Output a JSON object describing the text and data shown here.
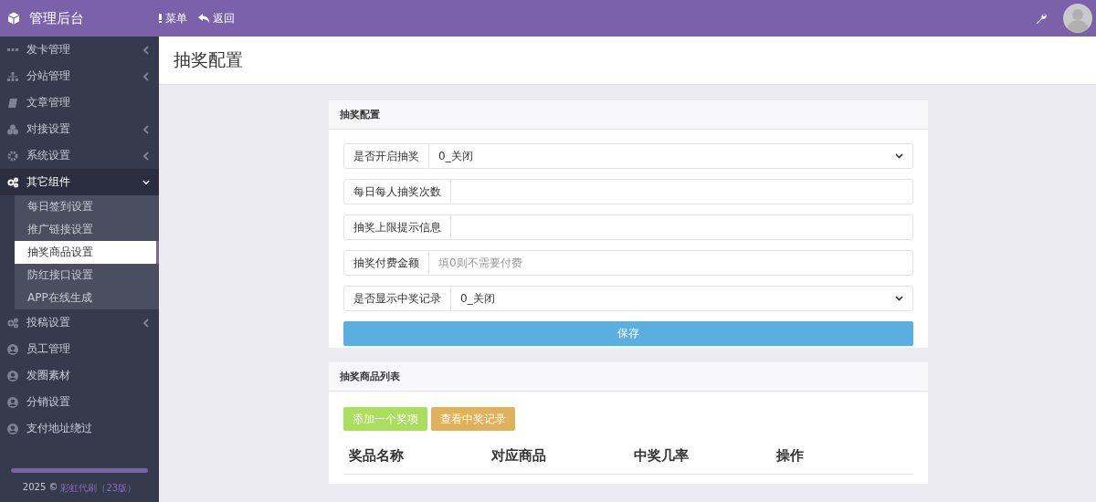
{
  "header": {
    "brand": "管理后台",
    "nav": [
      {
        "kind": "menu",
        "label": "菜单"
      },
      {
        "kind": "back",
        "label": "返回"
      }
    ]
  },
  "sidebar": {
    "items": [
      {
        "kind": "group",
        "label": "发卡管理",
        "expanded": false
      },
      {
        "kind": "group",
        "label": "分站管理",
        "expanded": false
      },
      {
        "kind": "link",
        "label": "文章管理",
        "expanded": false
      },
      {
        "kind": "group",
        "label": "对接设置",
        "expanded": false
      },
      {
        "kind": "group",
        "label": "系统设置",
        "expanded": false
      },
      {
        "kind": "group",
        "label": "其它组件",
        "expanded": true,
        "children": [
          {
            "label": "每日签到设置",
            "selected": false
          },
          {
            "label": "推广链接设置",
            "selected": false
          },
          {
            "label": "抽奖商品设置",
            "selected": true
          },
          {
            "label": "防红接口设置",
            "selected": false
          },
          {
            "label": "APP在线生成",
            "selected": false
          }
        ]
      },
      {
        "kind": "group",
        "label": "投稿设置",
        "expanded": false
      },
      {
        "kind": "link",
        "label": "员工管理",
        "expanded": false
      },
      {
        "kind": "link",
        "label": "发圈素材",
        "expanded": false
      },
      {
        "kind": "link",
        "label": "分销设置",
        "expanded": false
      },
      {
        "kind": "link",
        "label": "支付地址绕过",
        "expanded": false
      }
    ],
    "footer": {
      "year": "2025 ©",
      "link": "彩虹代刷（23版）"
    }
  },
  "page": {
    "title": "抽奖配置"
  },
  "config_panel": {
    "title": "抽奖配置",
    "fields": [
      {
        "kind": "select",
        "label": "是否开启抽奖",
        "value": "0_关闭"
      },
      {
        "kind": "input",
        "label": "每日每人抽奖次数"
      },
      {
        "kind": "input",
        "label": "抽奖上限提示信息"
      },
      {
        "kind": "input",
        "label": "抽奖付费金额",
        "placeholder": "填0则不需要付费"
      },
      {
        "kind": "select",
        "label": "是否显示中奖记录",
        "value": "0_关闭"
      }
    ],
    "save_button": "保存"
  },
  "list_panel": {
    "title": "抽奖商品列表",
    "buttons": [
      {
        "kind": "success",
        "label": "添加一个奖项"
      },
      {
        "kind": "warning",
        "label": "查看中奖记录"
      }
    ],
    "table": {
      "columns": [
        "奖品名称",
        "对应商品",
        "中奖几率",
        "操作"
      ]
    }
  }
}
